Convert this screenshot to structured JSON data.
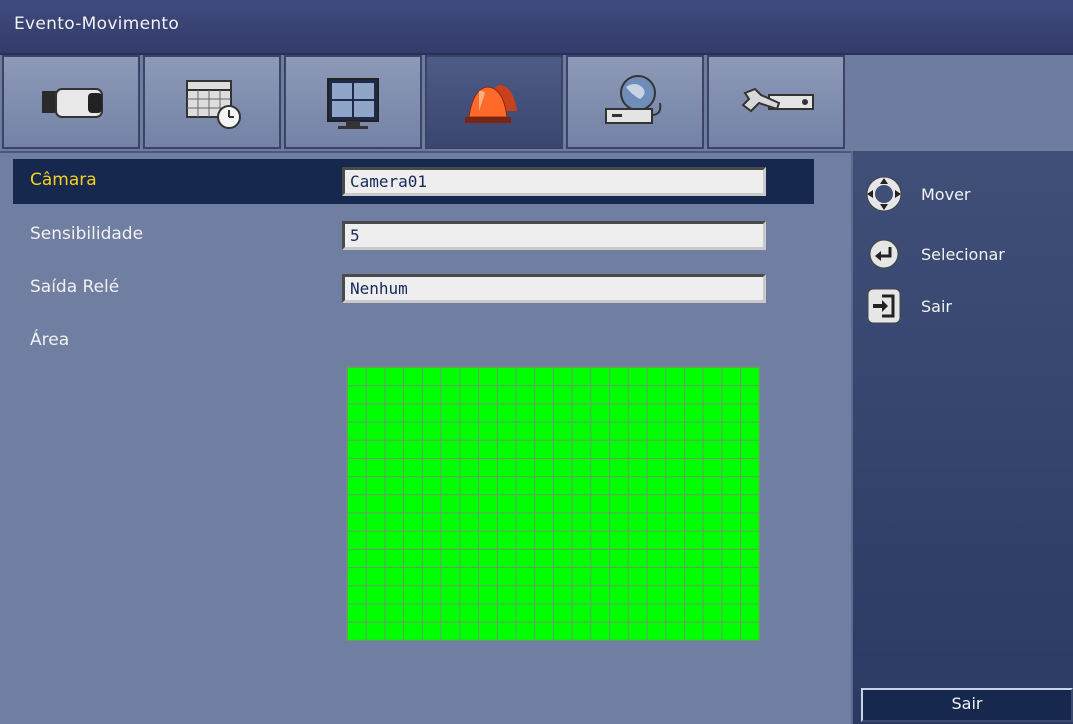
{
  "window": {
    "title": "Evento-Movimento"
  },
  "tabs": [
    {
      "name": "camera",
      "active": false
    },
    {
      "name": "schedule",
      "active": false
    },
    {
      "name": "display",
      "active": false
    },
    {
      "name": "alarm",
      "active": true
    },
    {
      "name": "network",
      "active": false
    },
    {
      "name": "system-tools",
      "active": false
    }
  ],
  "form": {
    "camara": {
      "label": "Câmara",
      "value": "Camera01"
    },
    "sensibilidade": {
      "label": "Sensibilidade",
      "value": "5"
    },
    "saida_rele": {
      "label": "Saída Relé",
      "value": "Nenhum"
    },
    "area": {
      "label": "Área",
      "grid_cols": 22,
      "grid_rows": 15
    }
  },
  "sidebar": {
    "hints": [
      {
        "icon": "dpad-icon",
        "label": "Mover"
      },
      {
        "icon": "enter-icon",
        "label": "Selecionar"
      },
      {
        "icon": "exit-icon",
        "label": "Sair"
      }
    ],
    "button_label": "Sair"
  },
  "colors": {
    "selected_label": "#f5d21a",
    "motion_area": "#00ff00",
    "selected_row": "#17284f"
  }
}
